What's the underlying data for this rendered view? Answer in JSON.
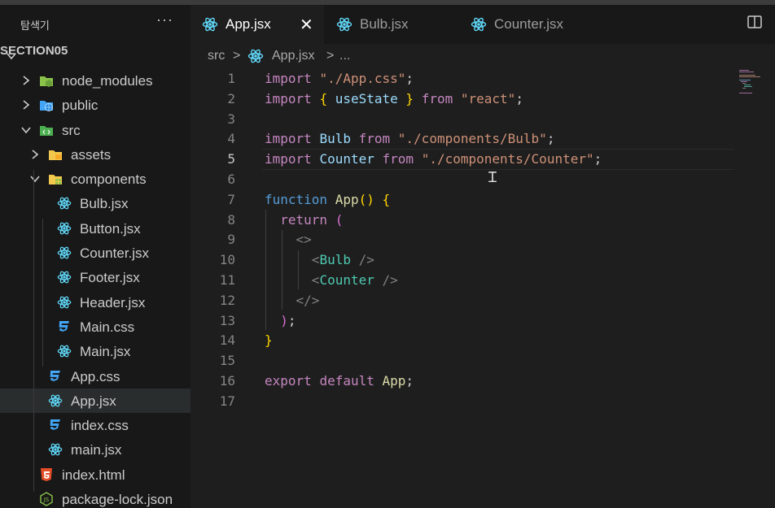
{
  "explorer": {
    "title": "탐색기",
    "more": "···",
    "section": "SECTION05",
    "items": [
      {
        "label": "node_modules"
      },
      {
        "label": "public"
      },
      {
        "label": "src"
      },
      {
        "label": "assets"
      },
      {
        "label": "components"
      },
      {
        "label": "Bulb.jsx"
      },
      {
        "label": "Button.jsx"
      },
      {
        "label": "Counter.jsx"
      },
      {
        "label": "Footer.jsx"
      },
      {
        "label": "Header.jsx"
      },
      {
        "label": "Main.css"
      },
      {
        "label": "Main.jsx"
      },
      {
        "label": "App.css"
      },
      {
        "label": "App.jsx"
      },
      {
        "label": "index.css"
      },
      {
        "label": "main.jsx"
      },
      {
        "label": "index.html"
      },
      {
        "label": "package-lock.json"
      }
    ]
  },
  "tabs": [
    {
      "label": "App.jsx",
      "close": "✕"
    },
    {
      "label": "Bulb.jsx"
    },
    {
      "label": "Counter.jsx"
    }
  ],
  "breadcrumb": {
    "folder": "src",
    "sep": ">",
    "file": "App.jsx",
    "rest": "..."
  },
  "editor": {
    "line_numbers": [
      "1",
      "2",
      "3",
      "4",
      "5",
      "6",
      "7",
      "8",
      "9",
      "10",
      "11",
      "12",
      "13",
      "14",
      "15",
      "16",
      "17"
    ],
    "lines": {
      "l1": {
        "kw": "import",
        "str": "\"./App.css\"",
        "semi": ";"
      },
      "l2": {
        "kw": "import",
        "ob": "{",
        "name": "useState",
        "cb": "}",
        "from": "from",
        "str": "\"react\"",
        "semi": ";"
      },
      "l4": {
        "kw": "import",
        "name": "Bulb",
        "from": "from",
        "str": "\"./components/Bulb\"",
        "semi": ";"
      },
      "l5": {
        "kw": "import",
        "name": "Counter",
        "from": "from",
        "str": "\"./components/Counter\"",
        "semi": ";"
      },
      "l7": {
        "kw": "function",
        "fn": "App",
        "parens": "()",
        "brace": "{"
      },
      "l8": {
        "kw": "return",
        "paren": "("
      },
      "l9": {
        "tag": "<>"
      },
      "l10": {
        "open": "<",
        "comp": "Bulb",
        "close": "/>"
      },
      "l11": {
        "open": "<",
        "comp": "Counter",
        "close": "/>"
      },
      "l12": {
        "tag": "</>"
      },
      "l13": {
        "paren": ")",
        "semi": ";"
      },
      "l14": {
        "brace": "}"
      },
      "l16": {
        "kw1": "export",
        "kw2": "default",
        "name": "App",
        "semi": ";"
      }
    }
  },
  "colors": {
    "react": "#61dafb",
    "css": "#42a5f5",
    "html": "#e44d26",
    "js": "#8bc34a",
    "node": "#8bc34a",
    "folder": "#f2c94c"
  }
}
